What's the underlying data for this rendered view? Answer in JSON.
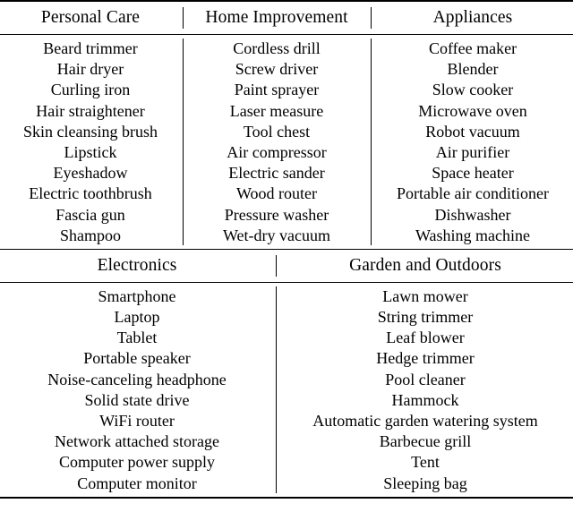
{
  "document": {
    "type": "table",
    "style": "booktabs",
    "text_color": "#000000",
    "background_color": "#ffffff"
  },
  "sections": [
    {
      "name": "section-upper",
      "headers": [
        "Personal Care",
        "Home Improvement",
        "Appliances"
      ],
      "columns": [
        {
          "header": "Personal Care",
          "items": [
            "Beard trimmer",
            "Hair dryer",
            "Curling iron",
            "Hair straightener",
            "Skin cleansing brush",
            "Lipstick",
            "Eyeshadow",
            "Electric toothbrush",
            "Fascia gun",
            "Shampoo"
          ]
        },
        {
          "header": "Home Improvement",
          "items": [
            "Cordless drill",
            "Screw driver",
            "Paint sprayer",
            "Laser measure",
            "Tool chest",
            "Air compressor",
            "Electric sander",
            "Wood router",
            "Pressure washer",
            "Wet-dry vacuum"
          ]
        },
        {
          "header": "Appliances",
          "items": [
            "Coffee maker",
            "Blender",
            "Slow cooker",
            "Microwave oven",
            "Robot vacuum",
            "Air purifier",
            "Space heater",
            "Portable air conditioner",
            "Dishwasher",
            "Washing machine"
          ]
        }
      ]
    },
    {
      "name": "section-lower",
      "headers": [
        "Electronics",
        "Garden and Outdoors"
      ],
      "columns": [
        {
          "header": "Electronics",
          "items": [
            "Smartphone",
            "Laptop",
            "Tablet",
            "Portable speaker",
            "Noise-canceling headphone",
            "Solid state drive",
            "WiFi router",
            "Network attached storage",
            "Computer power supply",
            "Computer monitor"
          ]
        },
        {
          "header": "Garden and Outdoors",
          "items": [
            "Lawn mower",
            "String trimmer",
            "Leaf blower",
            "Hedge trimmer",
            "Pool cleaner",
            "Hammock",
            "Automatic garden watering system",
            "Barbecue grill",
            "Tent",
            "Sleeping bag"
          ]
        }
      ]
    }
  ]
}
